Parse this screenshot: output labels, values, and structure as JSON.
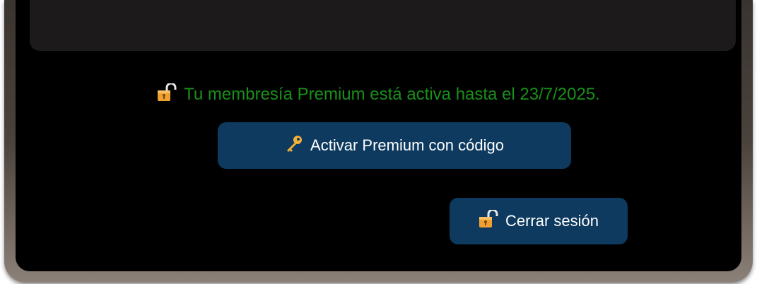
{
  "membership": {
    "status_text": "Tu membresía Premium está activa hasta el 23/7/2025.",
    "status_color": "#1a8f1a"
  },
  "actions": {
    "activate_label": "Activar Premium con código",
    "logout_label": "Cerrar sesión"
  },
  "icons": {
    "status": "unlocked-padlock-icon",
    "activate": "key-icon",
    "logout": "unlocked-padlock-icon"
  },
  "colors": {
    "button_bg": "#0d3a5e",
    "panel_bg": "#000000",
    "card_bg": "#1c1a1a"
  }
}
